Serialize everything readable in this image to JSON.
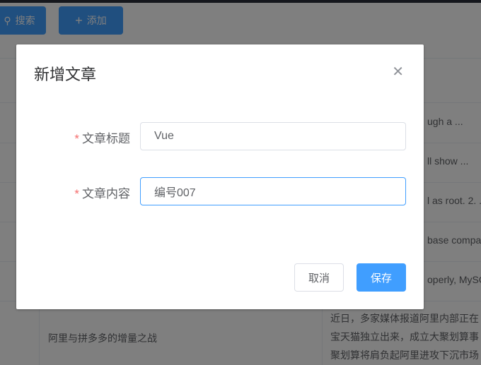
{
  "toolbar": {
    "search_label": "搜索",
    "add_label": "添加",
    "search_icon": "search-icon",
    "add_icon": "plus-icon"
  },
  "table": {
    "rows": [
      {
        "title": "",
        "content": "ugh a ..."
      },
      {
        "title": "",
        "content": "ll show ..."
      },
      {
        "title": "",
        "content": "l as root. 2. ..."
      },
      {
        "title": "",
        "content": "base compa"
      },
      {
        "title": "",
        "content": "operly, MySQ"
      },
      {
        "title": "阿里与拼多多的增量之战",
        "content_lines": [
          "近日，多家媒体报道阿里内部正在",
          "宝天猫独立出来，成立大聚划算事",
          "聚划算将肩负起阿里进攻下沉市场"
        ]
      }
    ]
  },
  "dialog": {
    "title": "新增文章",
    "fields": [
      {
        "label": "文章标题",
        "value": "Vue",
        "required": true
      },
      {
        "label": "文章内容",
        "value": "编号007",
        "required": true
      }
    ],
    "required_mark": "*",
    "cancel_label": "取消",
    "save_label": "保存"
  },
  "colors": {
    "primary": "#409eff",
    "required": "#f56c6c"
  }
}
